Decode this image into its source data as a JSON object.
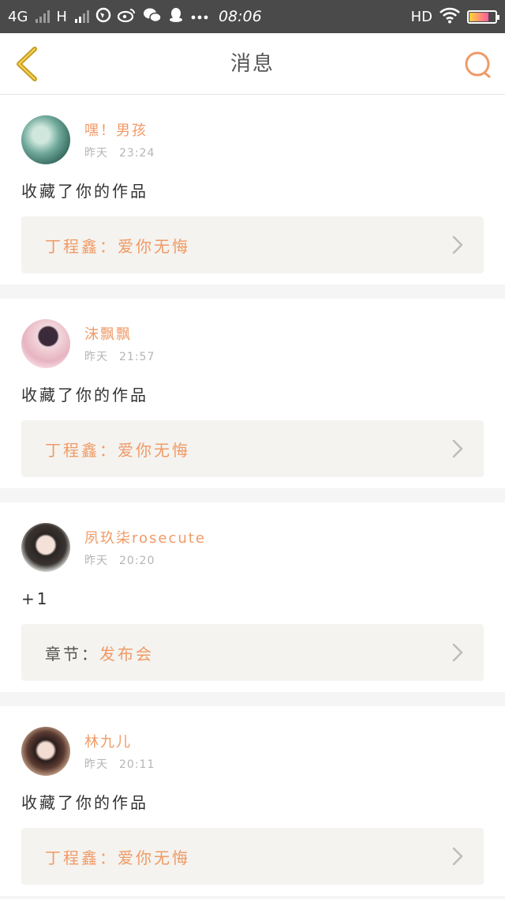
{
  "status_bar": {
    "network1": "4G",
    "network2": "H",
    "time": "08:06",
    "hd": "HD",
    "icons": [
      "signal-icon",
      "browser-icon",
      "weibo-icon",
      "wechat-icon",
      "qq-icon",
      "more-icon",
      "wifi-icon",
      "battery-icon"
    ]
  },
  "nav": {
    "title": "消息",
    "back_icon": "chevron-left-icon",
    "search_icon": "search-icon"
  },
  "colors": {
    "accent": "#f09a66",
    "back_icon": "#c79a1f",
    "card_ref_bg": "#f4f3ef"
  },
  "messages": [
    {
      "username": "嘿！男孩",
      "day": "昨天",
      "time": "23:24",
      "action": "收藏了你的作品",
      "ref_label": "丁程鑫：",
      "ref_value": "爱你无悔"
    },
    {
      "username": "沫飘飘",
      "day": "昨天",
      "time": "21:57",
      "action": "收藏了你的作品",
      "ref_label": "丁程鑫：",
      "ref_value": "爱你无悔"
    },
    {
      "username": "夙玖柒rosecute",
      "day": "昨天",
      "time": "20:20",
      "action": "+1",
      "ref_label": "章节：",
      "ref_value": "发布会"
    },
    {
      "username": "林九儿",
      "day": "昨天",
      "time": "20:11",
      "action": "收藏了你的作品",
      "ref_label": "丁程鑫：",
      "ref_value": "爱你无悔"
    }
  ]
}
